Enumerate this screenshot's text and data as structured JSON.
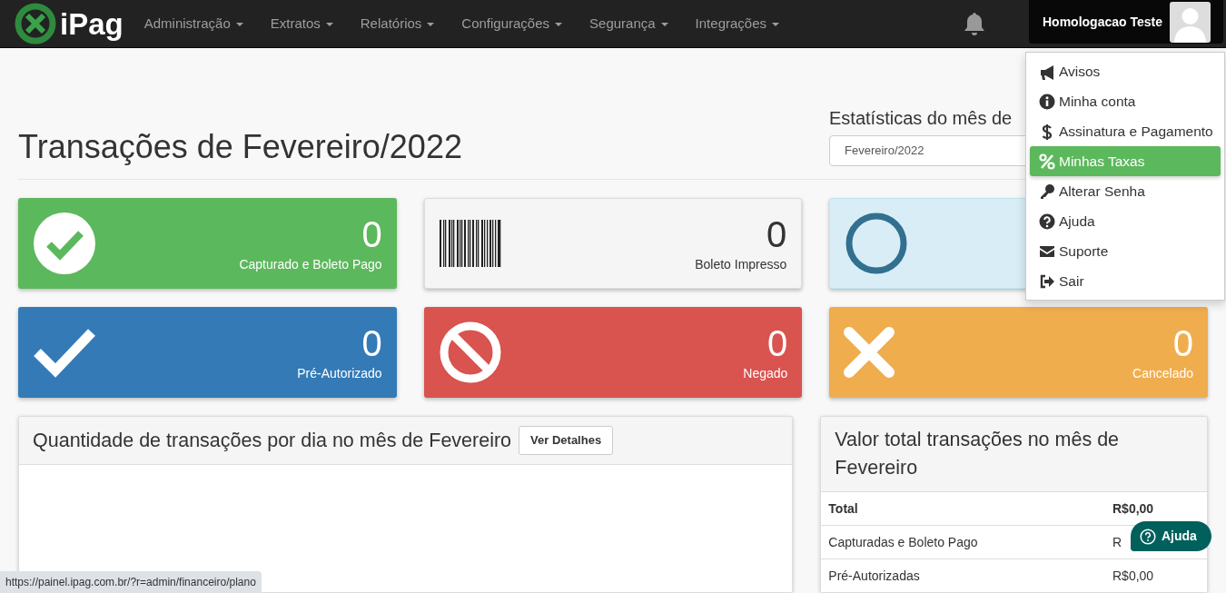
{
  "navbar": {
    "logo_text": "iPag",
    "menus": [
      {
        "label": "Administração"
      },
      {
        "label": "Extratos"
      },
      {
        "label": "Relatórios"
      },
      {
        "label": "Configurações"
      },
      {
        "label": "Segurança"
      },
      {
        "label": "Integrações"
      }
    ],
    "user_name": "Homologacao Teste"
  },
  "user_menu": [
    {
      "label": "Avisos",
      "kind": "megaphone",
      "selected": false
    },
    {
      "label": "Minha conta",
      "kind": "info",
      "selected": false
    },
    {
      "label": "Assinatura e Pagamento",
      "kind": "dollar",
      "selected": false
    },
    {
      "label": "Minhas Taxas",
      "kind": "percent",
      "selected": true
    },
    {
      "label": "Alterar Senha",
      "kind": "key",
      "selected": false
    },
    {
      "label": "Ajuda",
      "kind": "question",
      "selected": false
    },
    {
      "label": "Suporte",
      "kind": "envelope",
      "selected": false
    },
    {
      "label": "Sair",
      "kind": "signout",
      "selected": false
    }
  ],
  "page_title": "Transações de Fevereiro/2022",
  "stats_label": "Estatísticas do mês de",
  "month_select": {
    "value": "Fevereiro/2022"
  },
  "status_cards": [
    {
      "kind": "check-circle",
      "color": "#5cb85c",
      "count": "0",
      "label": "Capturado e Boleto Pago"
    },
    {
      "kind": "barcode",
      "color": "#f5f5f5",
      "count": "0",
      "label": "Boleto Impresso"
    },
    {
      "kind": "circle",
      "color": "#d9edf7"
    },
    {
      "kind": "check",
      "color": "#337ab7",
      "count": "0",
      "label": "Pré-Autorizado"
    },
    {
      "kind": "ban",
      "color": "#d9534f",
      "count": "0",
      "label": "Negado"
    },
    {
      "kind": "times",
      "color": "#f0ad4e",
      "count": "0",
      "label": "Cancelado"
    }
  ],
  "daily_panel": {
    "title": "Quantidade de transações por dia no mês de Fevereiro",
    "button": "Ver Detalhes"
  },
  "total_panel": {
    "title": "Valor total transações no mês de Fevereiro",
    "rows": [
      {
        "label": "Total",
        "value": "R$0,00",
        "bold": true
      },
      {
        "label": "Capturadas e Boleto Pago",
        "value": "R",
        "bold": false
      },
      {
        "label": "Pré-Autorizadas",
        "value": "R$0,00",
        "bold": false
      }
    ]
  },
  "help_button": "Ajuda",
  "status_bar": "https://painel.ipag.com.br/?r=admin/financeiro/plano"
}
